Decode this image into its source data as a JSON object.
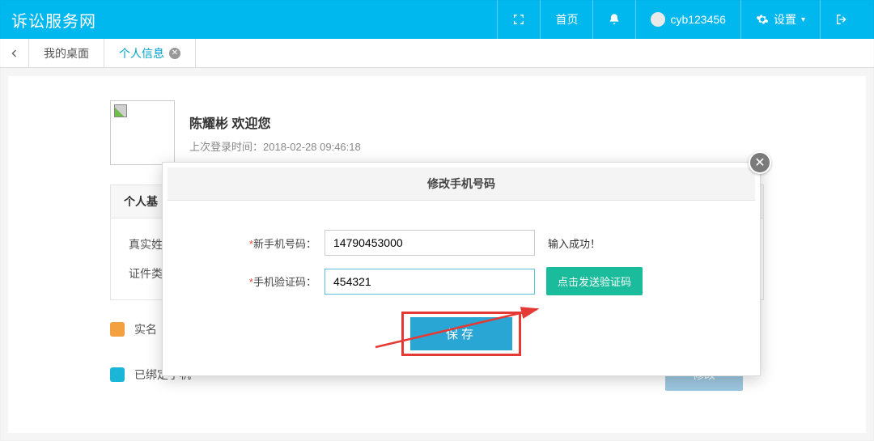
{
  "topbar": {
    "brand": "诉讼服务网",
    "home": "首页",
    "username": "cyb123456",
    "settings": "设置"
  },
  "tabs": {
    "desktop": "我的桌面",
    "profile": "个人信息"
  },
  "profile": {
    "welcome": "陈耀彬 欢迎您",
    "last_login_label": "上次登录时间：",
    "last_login_time": "2018-02-28 09:46:18",
    "section_title_partial": "个人基",
    "row_realname_partial": "真实姓",
    "row_idtype_partial": "证件类",
    "realname_status_partial": "实名",
    "phone_bound": "已绑定手机",
    "modify": "修改"
  },
  "modal": {
    "title": "修改手机号码",
    "phone_label": "新手机号码：",
    "phone_value": "14790453000",
    "phone_hint": "输入成功！",
    "code_label": "手机验证码：",
    "code_value": "454321",
    "send_code": "点击发送验证码",
    "save": "保存"
  }
}
